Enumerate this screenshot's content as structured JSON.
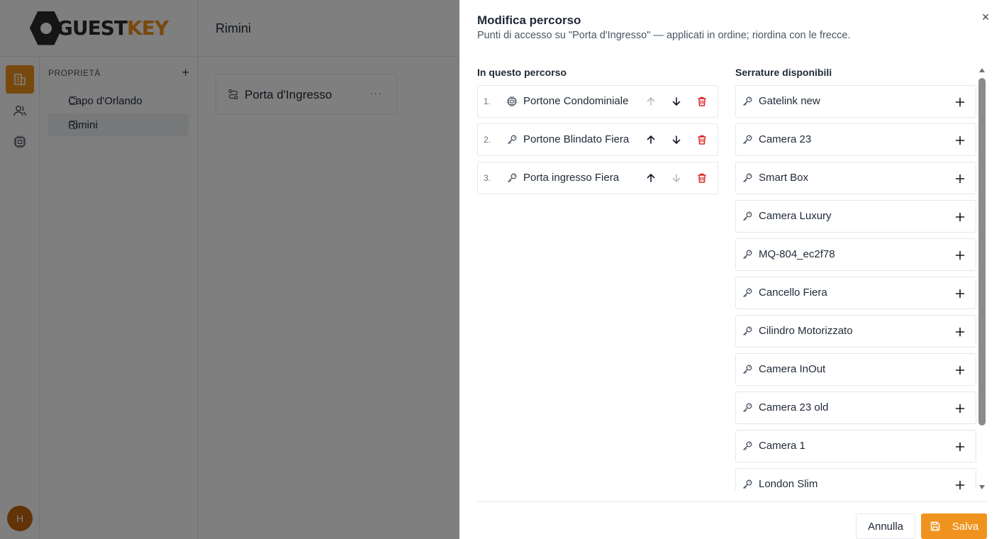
{
  "app": {
    "logo": {
      "text_main": "GUEST",
      "text_accent": "KEY"
    },
    "user_initial": "H",
    "rail": [
      {
        "icon": "building-icon",
        "active": true
      },
      {
        "icon": "users-icon",
        "active": false
      },
      {
        "icon": "chip-icon",
        "active": false
      }
    ]
  },
  "sidebar": {
    "heading": "PROPRIETÀ",
    "add": "+",
    "items": [
      {
        "label": "Capo d'Orlando",
        "selected": false
      },
      {
        "label": "Rimini",
        "selected": true
      }
    ]
  },
  "header": {
    "title": "Rimini"
  },
  "route_card": {
    "title": "Porta d'Ingresso",
    "more": "···"
  },
  "drawer": {
    "title": "Modifica percorso",
    "subtitle": "Punti di accesso su \"Porta d'Ingresso\" — applicati in ordine; riordina con le frecce.",
    "close": "×",
    "route_title": "In questo percorso",
    "available_title": "Serrature disponibili",
    "route_items": [
      {
        "num": "1.",
        "icon": "chip-icon",
        "name": "Portone Condominiale",
        "up_enabled": false,
        "down_enabled": true
      },
      {
        "num": "2.",
        "icon": "key-icon",
        "name": "Portone Blindato Fiera",
        "up_enabled": true,
        "down_enabled": true
      },
      {
        "num": "3.",
        "icon": "key-icon",
        "name": "Porta ingresso Fiera",
        "up_enabled": true,
        "down_enabled": false
      }
    ],
    "available_items": [
      {
        "name": "Gatelink new"
      },
      {
        "name": "Camera 23"
      },
      {
        "name": "Smart Box"
      },
      {
        "name": "Camera Luxury"
      },
      {
        "name": "MQ-804_ec2f78"
      },
      {
        "name": "Cancello Fiera"
      },
      {
        "name": "Cilindro Motorizzato"
      },
      {
        "name": "Camera InOut"
      },
      {
        "name": "Camera 23 old"
      },
      {
        "name": "Camera 1"
      },
      {
        "name": "London Slim"
      }
    ],
    "cancel_label": "Annulla",
    "save_label": "Salva"
  },
  "colors": {
    "accent": "#f0931e",
    "danger": "#dc2626",
    "overlay": "rgba(0,0,0,0.5)"
  }
}
